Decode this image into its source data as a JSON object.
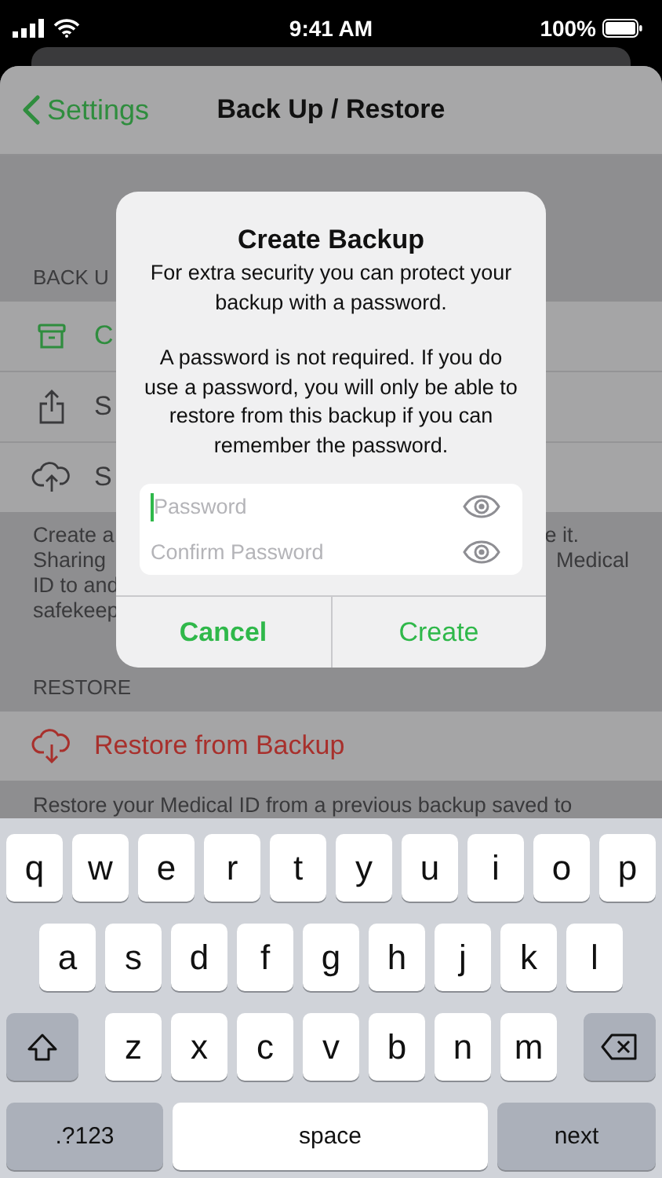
{
  "status_bar": {
    "time": "9:41 AM",
    "battery": "100%"
  },
  "nav": {
    "back": "Settings",
    "title": "Back Up / Restore"
  },
  "backup_section": {
    "header": "BACK U",
    "rows": [
      {
        "label": "C",
        "kind": "archive"
      },
      {
        "label": "S",
        "kind": "share"
      },
      {
        "label": "S",
        "kind": "upload"
      }
    ],
    "footer_left": [
      "Create a",
      "Sharing",
      "ID to and",
      "safekeep"
    ],
    "footer_right": [
      "e it.",
      "Medical"
    ]
  },
  "restore_section": {
    "header": "RESTORE",
    "rows": [
      {
        "label": "Restore from Backup",
        "kind": "download"
      }
    ],
    "footer": "Restore your Medical ID from a previous backup saved to"
  },
  "dialog": {
    "title": "Create Backup",
    "message": [
      "For extra security you can protect your backup with a password.",
      "A password is not required. If you do use a password, you will only be able to restore from this backup if you can remember the password."
    ],
    "fields": [
      {
        "placeholder": "Password",
        "focused": true
      },
      {
        "placeholder": "Confirm Password",
        "focused": false
      }
    ],
    "buttons": [
      {
        "label": "Cancel",
        "kind": "cancel"
      },
      {
        "label": "Create",
        "kind": "default"
      }
    ]
  },
  "keyboard": {
    "rows": [
      [
        "q",
        "w",
        "e",
        "r",
        "t",
        "y",
        "u",
        "i",
        "o",
        "p"
      ],
      [
        "a",
        "s",
        "d",
        "f",
        "g",
        "h",
        "j",
        "k",
        "l"
      ],
      [
        "z",
        "x",
        "c",
        "v",
        "b",
        "n",
        "m"
      ]
    ],
    "mode_key": ".?123",
    "space_key": "space",
    "return_key": "next"
  }
}
